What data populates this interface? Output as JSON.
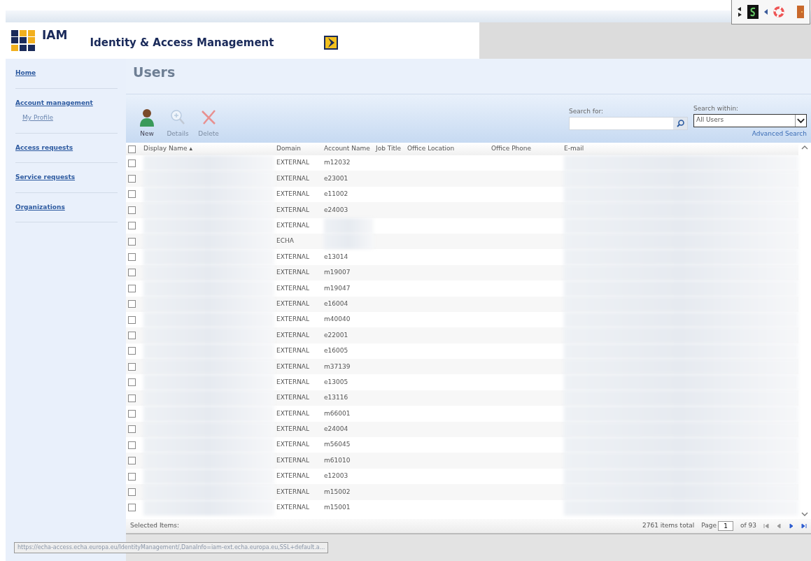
{
  "header": {
    "logo_text": "IAM",
    "title": "Identity & Access Management"
  },
  "sidebar": {
    "items": [
      {
        "label": "Home"
      },
      {
        "label": "Account management",
        "children": [
          {
            "label": "My Profile"
          }
        ]
      },
      {
        "label": "Access requests"
      },
      {
        "label": "Service requests"
      },
      {
        "label": "Organizations"
      }
    ]
  },
  "page_title": "Users",
  "toolbar": [
    {
      "label": "New",
      "kind": "new",
      "disabled": false
    },
    {
      "label": "Details",
      "kind": "details",
      "disabled": true
    },
    {
      "label": "Delete",
      "kind": "delete",
      "disabled": true
    }
  ],
  "search": {
    "label": "Search for:",
    "within_label": "Search within:",
    "within_value": "All Users",
    "advanced": "Advanced Search"
  },
  "table": {
    "select_all_checked": false,
    "columns": [
      "Display Name ▴",
      "Domain",
      "Account Name",
      "Job Title",
      "Office Location",
      "Office Phone",
      "E-mail"
    ],
    "rows": [
      {
        "checked": false,
        "domain": "EXTERNAL",
        "account": "m12032",
        "account_redacted": false
      },
      {
        "checked": false,
        "domain": "EXTERNAL",
        "account": "e23001",
        "account_redacted": false
      },
      {
        "checked": false,
        "domain": "EXTERNAL",
        "account": "e11002",
        "account_redacted": false
      },
      {
        "checked": false,
        "domain": "EXTERNAL",
        "account": "e24003",
        "account_redacted": false
      },
      {
        "checked": false,
        "domain": "EXTERNAL",
        "account_redacted": true
      },
      {
        "checked": false,
        "domain": "ECHA",
        "account_redacted": true
      },
      {
        "checked": false,
        "domain": "EXTERNAL",
        "account": "e13014",
        "account_redacted": false
      },
      {
        "checked": false,
        "domain": "EXTERNAL",
        "account": "m19007",
        "account_redacted": false
      },
      {
        "checked": false,
        "domain": "EXTERNAL",
        "account": "m19047",
        "account_redacted": false
      },
      {
        "checked": false,
        "domain": "EXTERNAL",
        "account": "e16004",
        "account_redacted": false
      },
      {
        "checked": false,
        "domain": "EXTERNAL",
        "account": "m40040",
        "account_redacted": false
      },
      {
        "checked": false,
        "domain": "EXTERNAL",
        "account": "e22001",
        "account_redacted": false
      },
      {
        "checked": false,
        "domain": "EXTERNAL",
        "account": "e16005",
        "account_redacted": false
      },
      {
        "checked": false,
        "domain": "EXTERNAL",
        "account": "m37139",
        "account_redacted": false
      },
      {
        "checked": false,
        "domain": "EXTERNAL",
        "account": "e13005",
        "account_redacted": false
      },
      {
        "checked": false,
        "domain": "EXTERNAL",
        "account": "e13116",
        "account_redacted": false
      },
      {
        "checked": false,
        "domain": "EXTERNAL",
        "account": "m66001",
        "account_redacted": false
      },
      {
        "checked": false,
        "domain": "EXTERNAL",
        "account": "e24004",
        "account_redacted": false
      },
      {
        "checked": false,
        "domain": "EXTERNAL",
        "account": "m56045",
        "account_redacted": false
      },
      {
        "checked": false,
        "domain": "EXTERNAL",
        "account": "m61010",
        "account_redacted": false
      },
      {
        "checked": false,
        "domain": "EXTERNAL",
        "account": "e12003",
        "account_redacted": false
      },
      {
        "checked": false,
        "domain": "EXTERNAL",
        "account": "m15002",
        "account_redacted": false
      },
      {
        "checked": false,
        "domain": "EXTERNAL",
        "account": "m15001",
        "account_redacted": false
      }
    ]
  },
  "footer": {
    "selected_label": "Selected Items:",
    "total": "2761 items total",
    "page_label": "Page",
    "page_value": "1",
    "page_of": "of 93"
  },
  "status_url": "https://echa-access.echa.europa.eu/IdentityManagement/,DanaInfo=iam-ext.echa.europa.eu,SSL+default.a..."
}
